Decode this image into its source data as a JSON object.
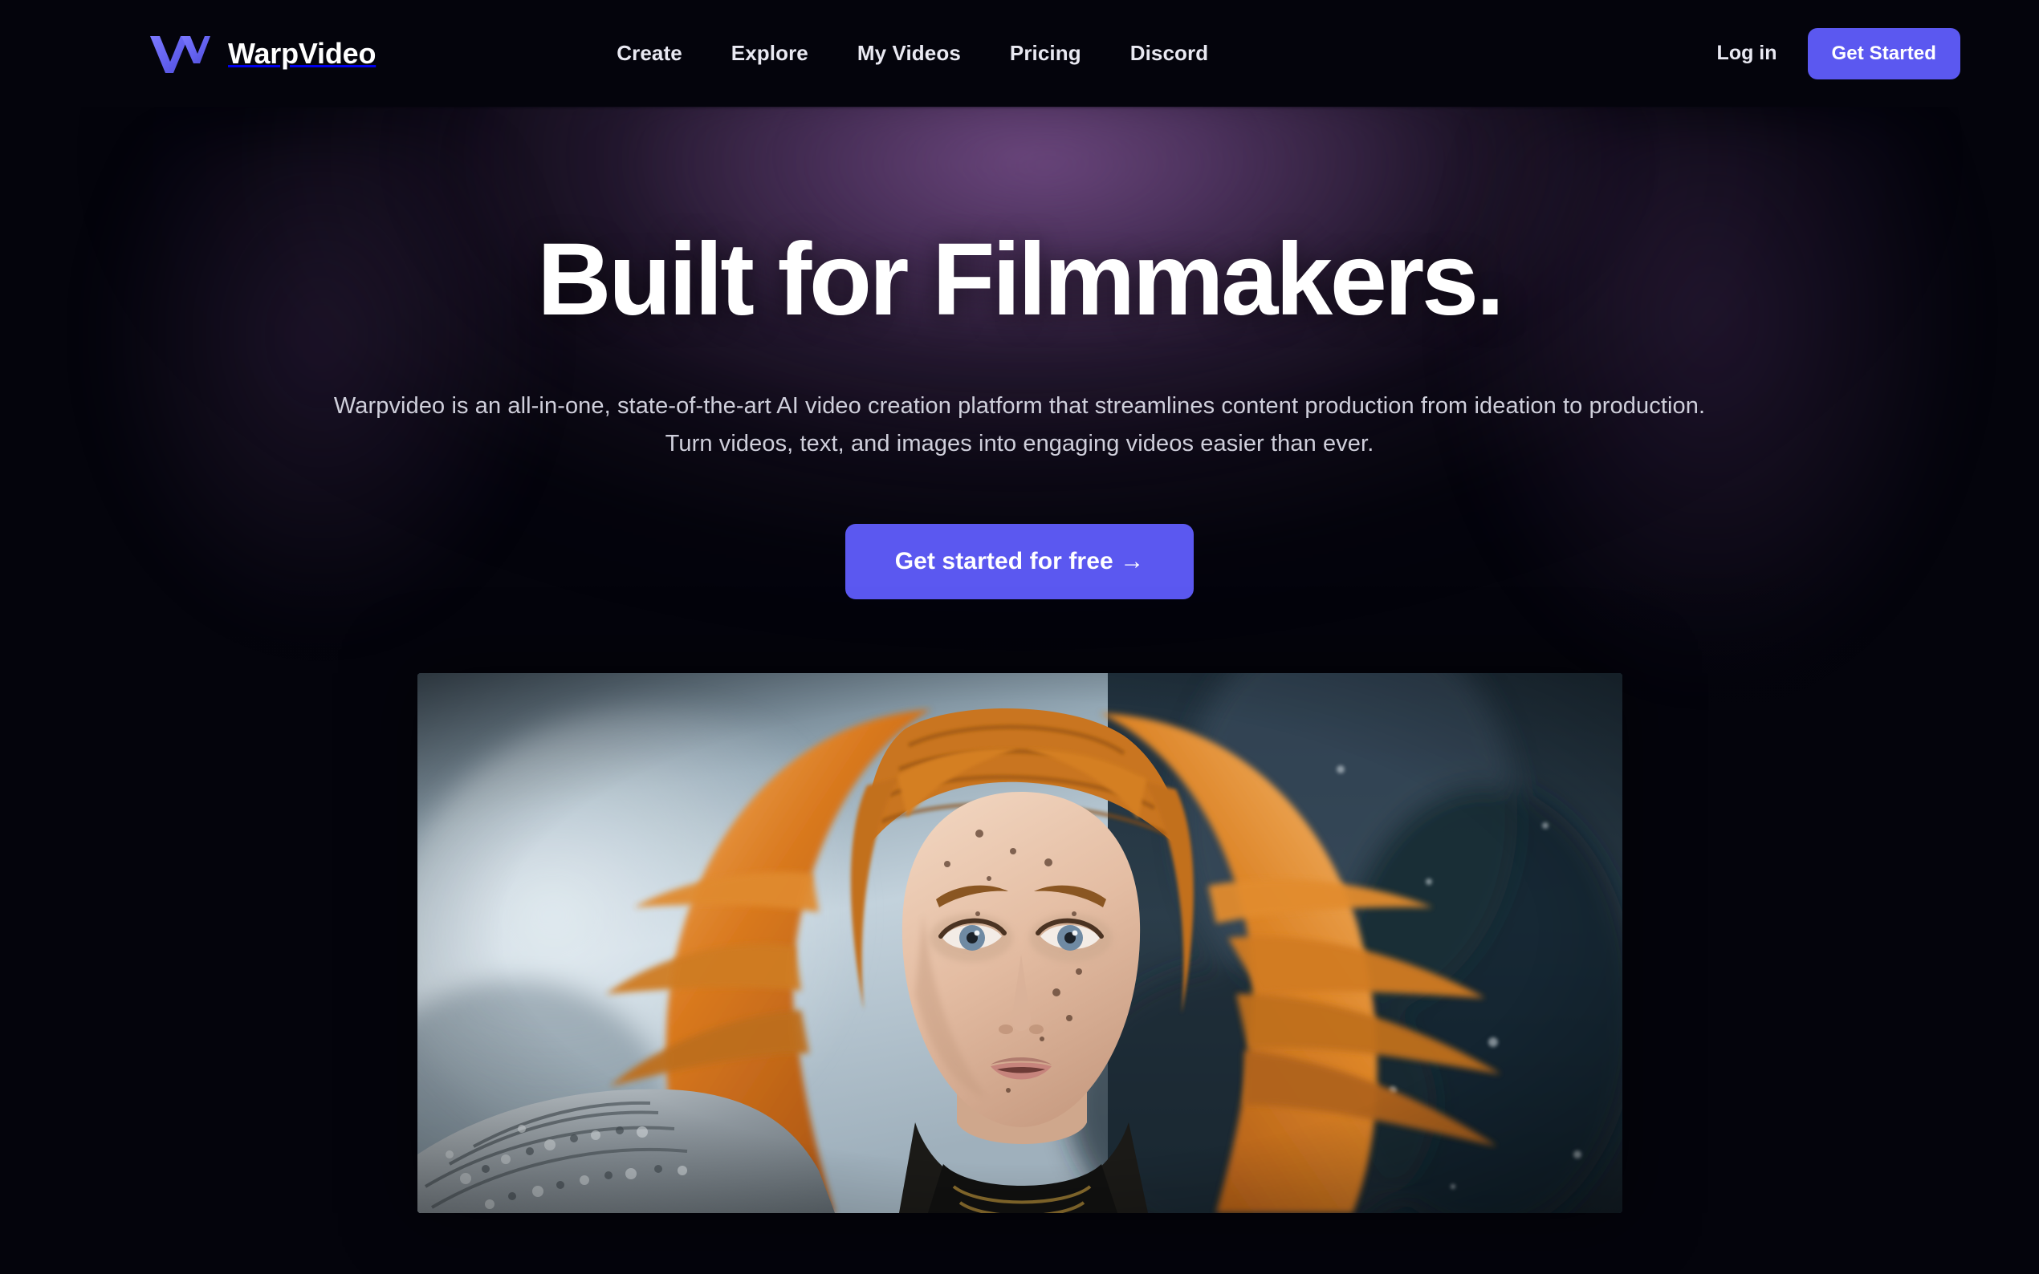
{
  "brand": {
    "name": "WarpVideo",
    "logo_icon": "warp-w-logo-icon",
    "logo_color_from": "#6f6df5",
    "logo_color_to": "#4f4dd8"
  },
  "nav": {
    "links": [
      {
        "label": "Create"
      },
      {
        "label": "Explore"
      },
      {
        "label": "My Videos"
      },
      {
        "label": "Pricing"
      },
      {
        "label": "Discord"
      }
    ],
    "login_label": "Log in",
    "get_started_label": "Get Started",
    "accent_color": "#5B58F0"
  },
  "hero": {
    "title": "Built for Filmmakers.",
    "subtitle": "Warpvideo is an all-in-one, state-of-the-art AI video creation platform that streamlines content production from ideation to production. Turn videos, text, and images into engaging videos easier than ever.",
    "cta_label": "Get started for free →",
    "cta_color": "#5B58F0",
    "glow_color": "#5f3e70",
    "background_color": "#04040c"
  },
  "showcase": {
    "alt": "AI generated video still of a red-haired woman in chainmail armor in a snowy winter scene",
    "palette": {
      "sky": "#ccd8e0",
      "sky_dark": "#2e3d49",
      "hair": "#d4741f",
      "hair_light": "#f0a14c",
      "skin": "#e8c3ab",
      "chainmail": "#9aa3a8",
      "backdrop": "#1d2a33"
    }
  }
}
